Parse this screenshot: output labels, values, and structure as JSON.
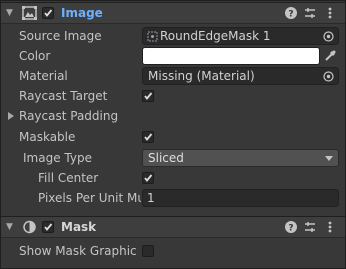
{
  "image_component": {
    "title": "Image",
    "enabled": true,
    "fields": {
      "source_image": {
        "label": "Source Image",
        "value": "RoundEdgeMask 1"
      },
      "color": {
        "label": "Color",
        "value": "#ffffff"
      },
      "material": {
        "label": "Material",
        "value": "Missing (Material)"
      },
      "raycast_target": {
        "label": "Raycast Target",
        "checked": true
      },
      "raycast_padding": {
        "label": "Raycast Padding"
      },
      "maskable": {
        "label": "Maskable",
        "checked": true
      },
      "image_type": {
        "label": "Image Type",
        "value": "Sliced"
      },
      "fill_center": {
        "label": "Fill Center",
        "checked": true
      },
      "pixels_per_unit": {
        "label": "Pixels Per Unit Mul",
        "value": "1"
      }
    }
  },
  "mask_component": {
    "title": "Mask",
    "enabled": true,
    "fields": {
      "show_mask_graphic": {
        "label": "Show Mask Graphic",
        "checked": false
      }
    }
  },
  "colors": {
    "panel_bg": "#383838",
    "header_bg": "#3e3e3e",
    "field_bg": "#2a2a2a",
    "dropdown_bg": "#515151",
    "text": "#c4c4c4"
  }
}
